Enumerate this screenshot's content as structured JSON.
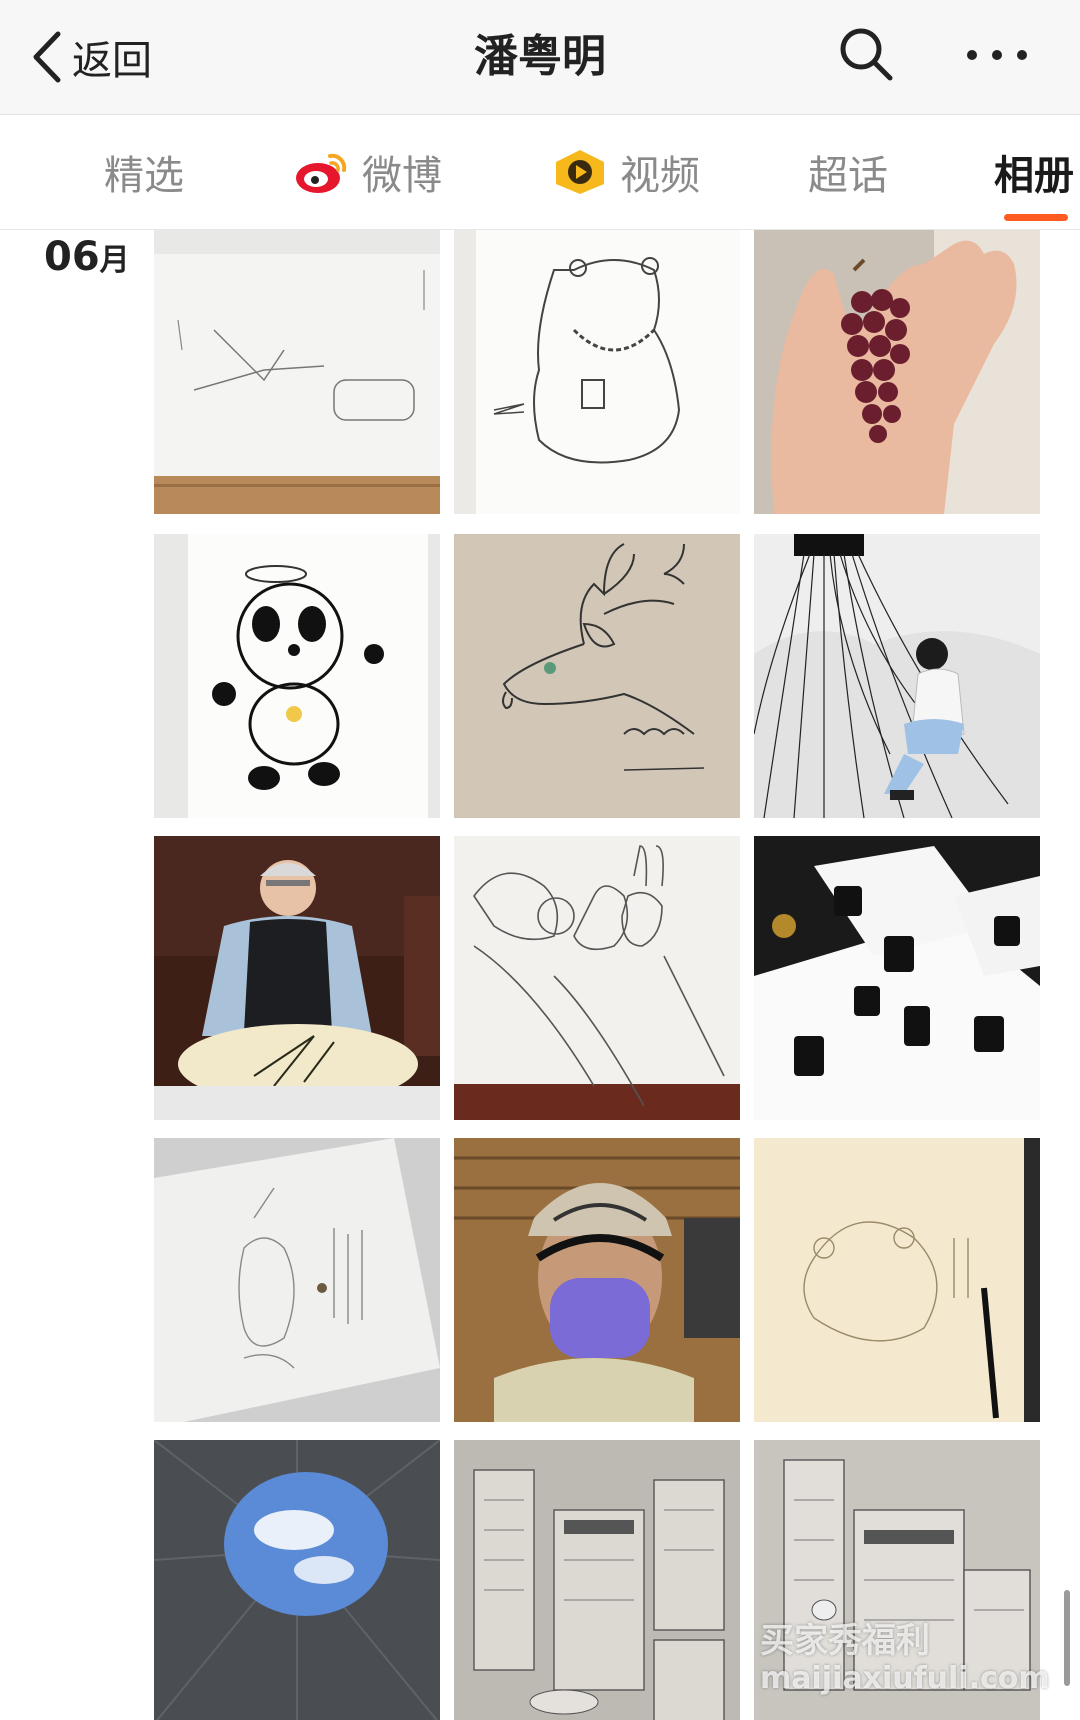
{
  "header": {
    "back_label": "返回",
    "title": "潘粤明"
  },
  "tabs": [
    {
      "label": "精选",
      "icon": null,
      "active": false
    },
    {
      "label": "微博",
      "icon": "weibo-logo-icon",
      "active": false
    },
    {
      "label": "视频",
      "icon": "video-logo-icon",
      "active": false
    },
    {
      "label": "超话",
      "icon": null,
      "active": false
    },
    {
      "label": "相册",
      "icon": null,
      "active": true
    }
  ],
  "album": {
    "month_number": "06",
    "month_unit": "月",
    "photos": [
      "sketch-paper",
      "panda-bear-drawing",
      "grapes-in-hand",
      "panda-robot-drawing",
      "deer-drawing",
      "man-with-strings",
      "elder-with-painting",
      "rabbit-sketch",
      "calligraphy-papers",
      "pencil-sketch-page",
      "man-in-mask-cap",
      "bear-pencil-sketch",
      "sky-through-hole",
      "city-sketch-1",
      "city-sketch-2"
    ]
  },
  "watermark": {
    "line1": "买家秀福利",
    "line2": "maijiaxiufuli.com"
  },
  "colors": {
    "accent": "#ff5a1f",
    "topbar_bg": "#f7f7f7",
    "tab_inactive": "#8a8a8a"
  }
}
